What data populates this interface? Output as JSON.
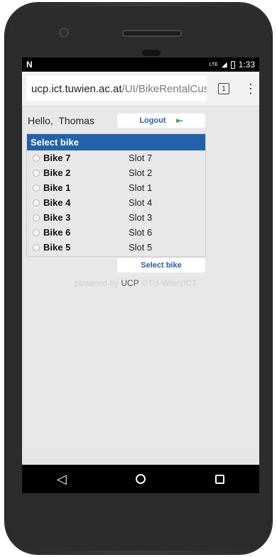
{
  "status": {
    "carrier_icon": "N",
    "network": "LTE",
    "time": "1:33"
  },
  "browser": {
    "url_host": "ucp.ict.tuwien.ac.at",
    "url_path": "/UI/BikeRentalCus",
    "tab_count": "1",
    "menu": "⋮"
  },
  "page": {
    "greeting": "Hello,  Thomas",
    "logout_label": "Logout",
    "panel_title": "Select bike",
    "bikes": [
      {
        "name": "Bike 7",
        "slot": "Slot 7"
      },
      {
        "name": "Bike 2",
        "slot": "Slot 2"
      },
      {
        "name": "Bike 1",
        "slot": "Slot 1"
      },
      {
        "name": "Bike 4",
        "slot": "Slot 4"
      },
      {
        "name": "Bike 3",
        "slot": "Slot 3"
      },
      {
        "name": "Bike 6",
        "slot": "Slot 6"
      },
      {
        "name": "Bike 5",
        "slot": "Slot 5"
      }
    ],
    "select_button_label": "Select bike",
    "footer_prefix": "powered by ",
    "footer_brand": "UCP",
    "footer_suffix": " ©TU-Wien/ICT"
  },
  "colors": {
    "header_bg": "#2262aa",
    "link_blue": "#2a5ea8",
    "logout_icon": "#3aa34a"
  },
  "icons": {
    "logout": "exit-arrow-icon",
    "back": "back-triangle-icon",
    "home": "home-circle-icon",
    "recents": "recents-square-icon"
  }
}
